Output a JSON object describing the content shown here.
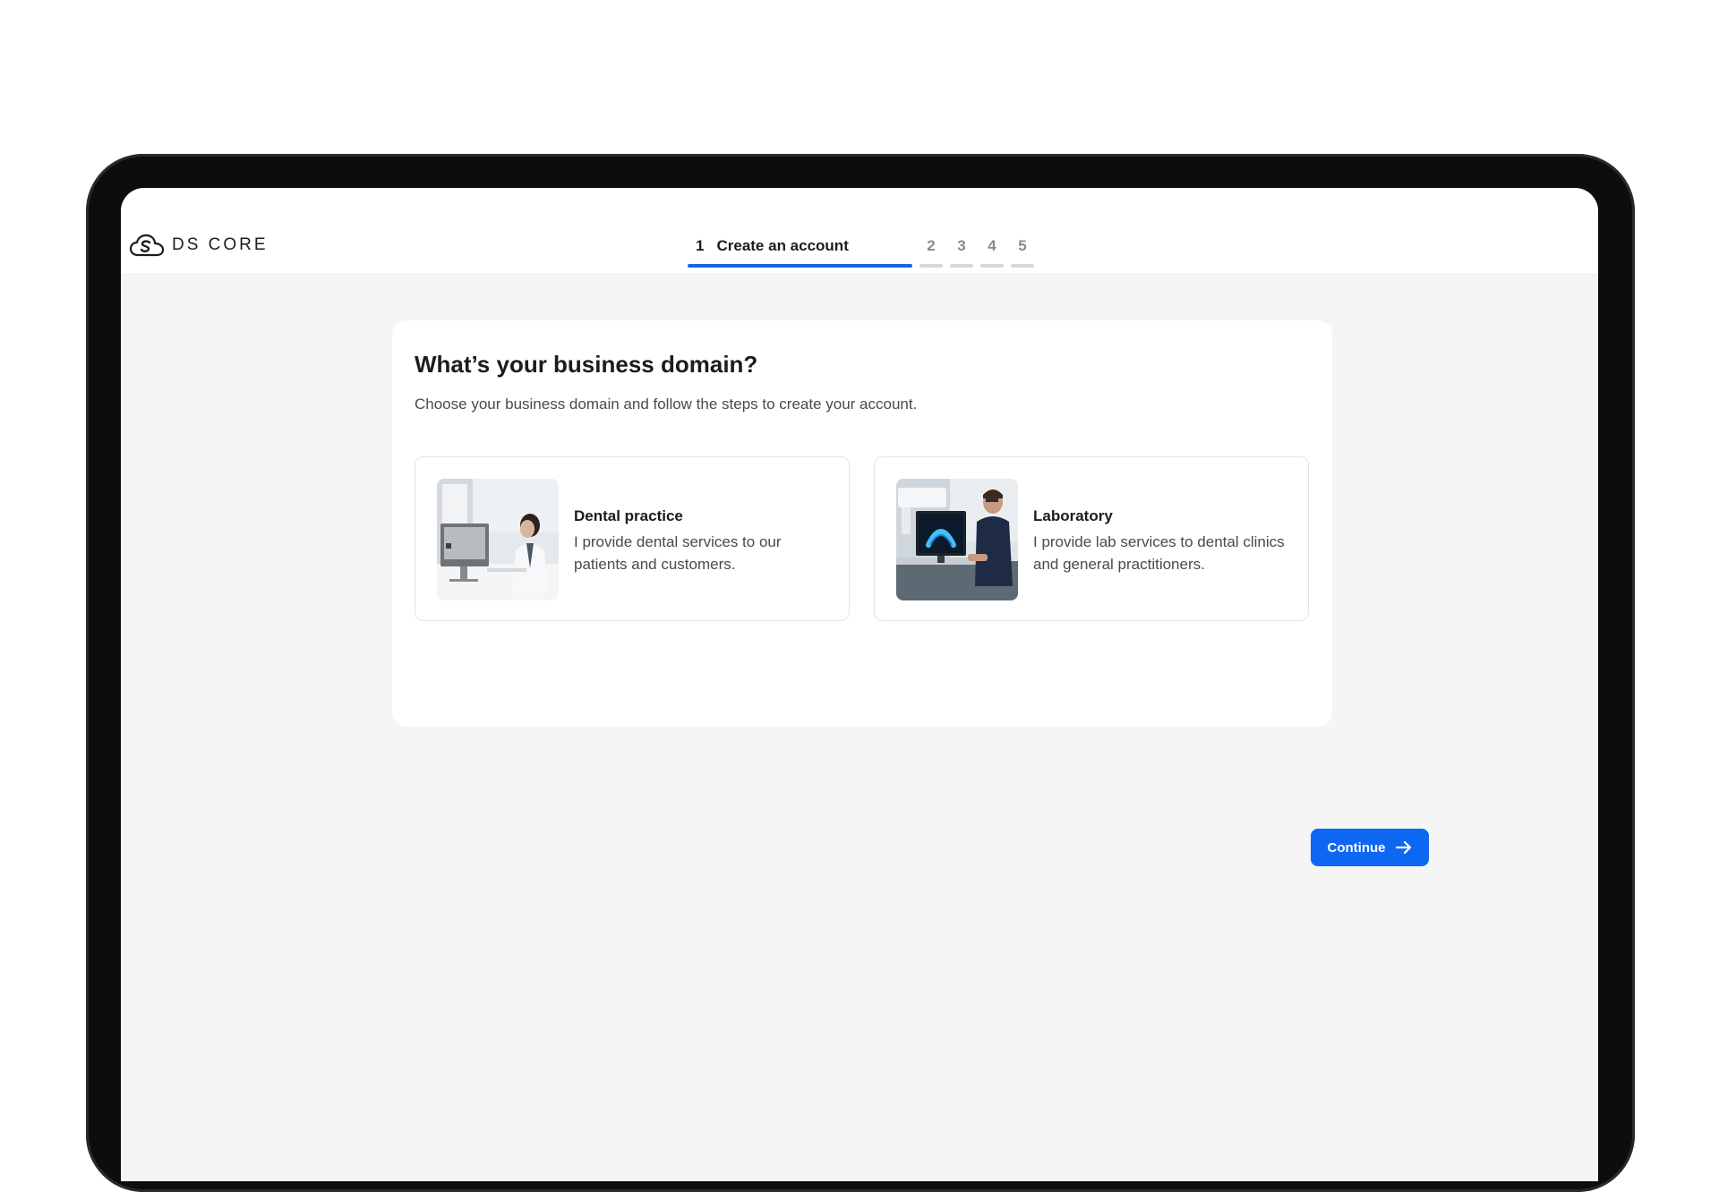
{
  "app": {
    "brand": "DS CORE"
  },
  "stepper": {
    "active": {
      "number": "1",
      "label": "Create an account"
    },
    "steps": [
      "2",
      "3",
      "4",
      "5"
    ],
    "accent": "#1565e6",
    "inactive_color": "#d8d8dc"
  },
  "main": {
    "title": "What’s your business domain?",
    "subtitle": "Choose your business domain and follow the steps to create your account.",
    "options": [
      {
        "title": "Dental practice",
        "description": "I provide dental services to our patients and customers.",
        "image": "dentist-at-computer-photo"
      },
      {
        "title": "Laboratory",
        "description": "I provide lab services to dental clinics and general practitioners.",
        "image": "lab-technician-at-computer-photo"
      }
    ],
    "continue_label": "Continue",
    "continue_icon": "arrow-right-icon",
    "button_color": "#0d67f3"
  }
}
